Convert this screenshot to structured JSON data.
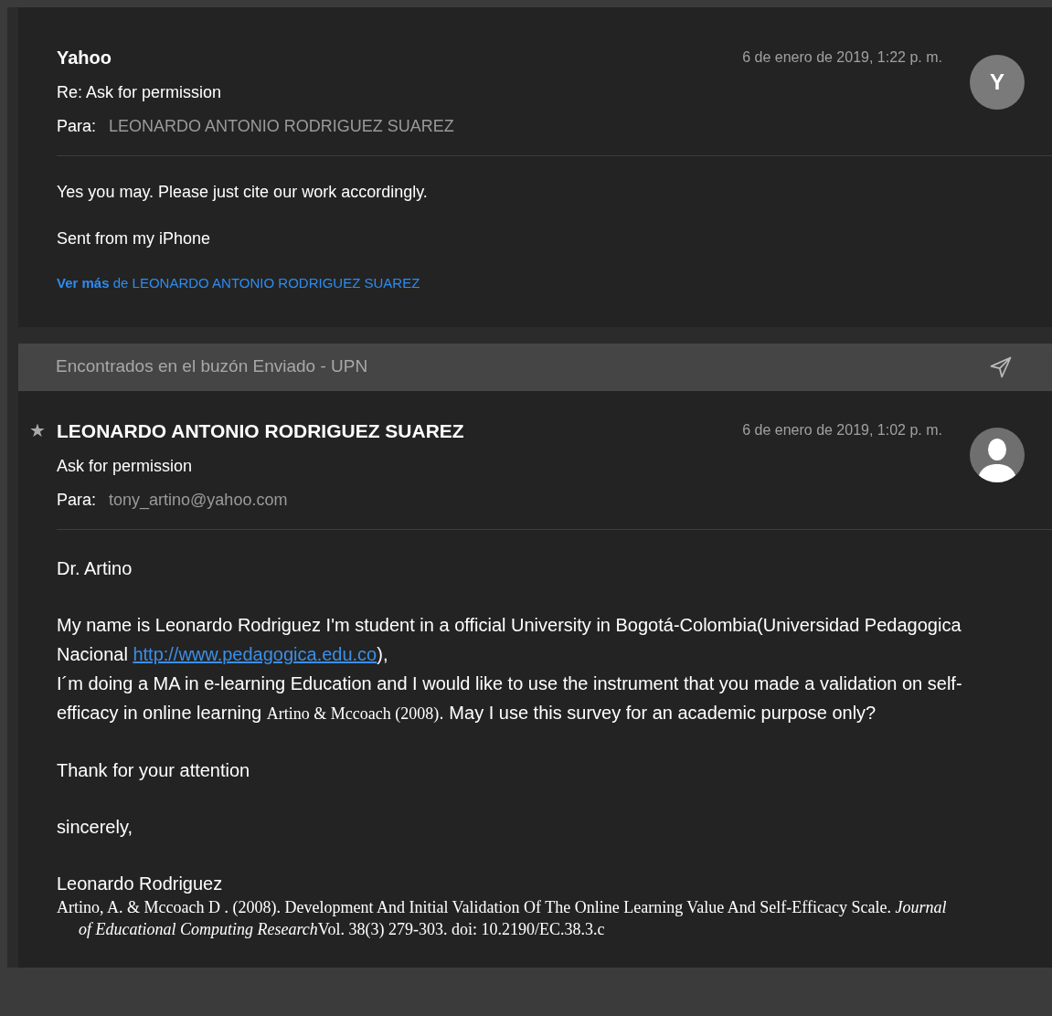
{
  "messages": [
    {
      "sender": "Yahoo",
      "date": "6 de enero de 2019, 1:22 p. m.",
      "subject": "Re: Ask for permission",
      "to_label": "Para:",
      "to": "LEONARDO ANTONIO RODRIGUEZ SUAREZ",
      "avatar": {
        "kind": "letter",
        "letter": "Y"
      },
      "body": [
        {
          "kind": "para",
          "segments": [
            {
              "kind": "text",
              "text": "Yes you may. Please just cite our work accordingly."
            }
          ]
        },
        {
          "kind": "para",
          "segments": [
            {
              "kind": "text",
              "text": "Sent from my iPhone"
            }
          ]
        },
        {
          "kind": "more",
          "segments": [
            {
              "kind": "text",
              "text": "**Ver más** de LEONARDO ANTONIO RODRIGUEZ SUAREZ"
            }
          ]
        }
      ]
    },
    {
      "banner": "Encontrados en el buzón Enviado - UPN",
      "sender": "LEONARDO ANTONIO RODRIGUEZ SUAREZ",
      "date": "6 de enero de 2019, 1:02 p. m.",
      "subject": "Ask for permission",
      "to_label": "Para:",
      "to": "tony_artino@yahoo.com",
      "avatar": {
        "kind": "person"
      },
      "starred": true,
      "star": "★",
      "body": [
        {
          "kind": "para",
          "segments": [
            {
              "kind": "text",
              "text": "Dr. Artino"
            }
          ]
        },
        {
          "kind": "para",
          "segments": [
            {
              "kind": "text",
              "text": "My name is Leonardo Rodriguez I'm student in a official University in Bogotá-Colombia(Universidad Pedagogica Nacional "
            },
            {
              "kind": "link",
              "text": "http://www.pedagogica.edu.co"
            },
            {
              "kind": "text",
              "text": "),"
            },
            {
              "kind": "br"
            },
            {
              "kind": "text",
              "text": "I´m doing a MA in e-learning Education and I would like to use the instrument that you made a validation on self-efficacy in online learning "
            },
            {
              "kind": "serif",
              "text": "Artino & Mccoach (2008)"
            },
            {
              "kind": "text",
              "text": ". May I use this survey for an academic purpose only?"
            }
          ]
        },
        {
          "kind": "para",
          "segments": [
            {
              "kind": "text",
              "text": "Thank for your attention"
            }
          ]
        },
        {
          "kind": "para",
          "segments": [
            {
              "kind": "text",
              "text": "sincerely,"
            }
          ]
        },
        {
          "kind": "signature",
          "segments": [
            {
              "kind": "text",
              "text": "Leonardo Rodriguez"
            }
          ]
        },
        {
          "kind": "reference",
          "segments": [
            {
              "kind": "text",
              "text": "Artino, A. & Mccoach D . (2008). Development And Initial Validation Of The Online Learning Value And Self-Efficacy Scale. "
            },
            {
              "kind": "italic",
              "text": "Journal of Educational Computing Research"
            },
            {
              "kind": "text",
              "text": "Vol. 38(3) 279-303. doi: 10.2190/EC.38.3.c"
            }
          ]
        }
      ]
    }
  ]
}
